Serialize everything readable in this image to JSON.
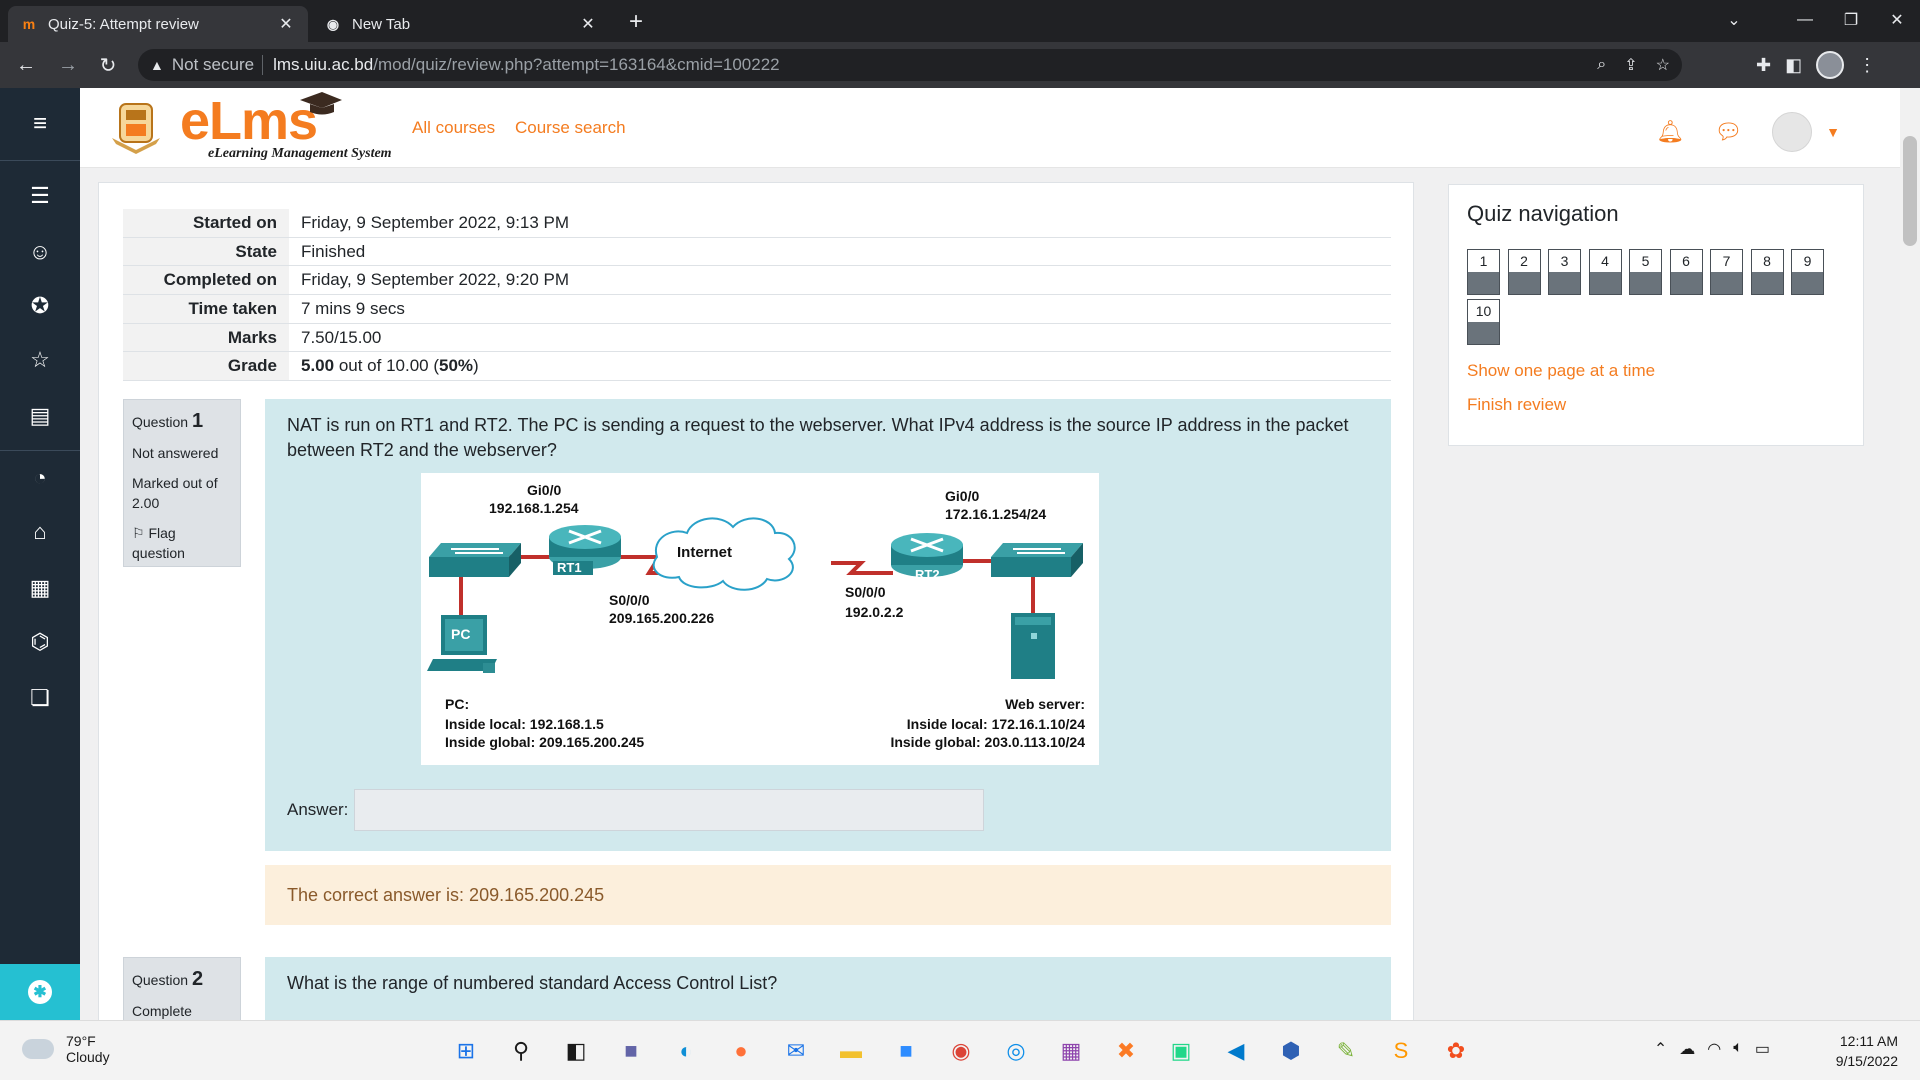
{
  "browser": {
    "tabs": [
      {
        "title": "Quiz-5: Attempt review",
        "active": true
      },
      {
        "title": "New Tab",
        "active": false
      }
    ],
    "security_label": "Not secure",
    "url_host": "lms.uiu.ac.bd",
    "url_path": "/mod/quiz/review.php?attempt=163164&cmid=100222"
  },
  "site": {
    "logo_text": "eLms",
    "logo_subtitle": "eLearning Management System",
    "links": [
      "All courses",
      "Course search"
    ]
  },
  "summary": [
    {
      "label": "Started on",
      "value": "Friday, 9 September 2022, 9:13 PM"
    },
    {
      "label": "State",
      "value": "Finished"
    },
    {
      "label": "Completed on",
      "value": "Friday, 9 September 2022, 9:20 PM"
    },
    {
      "label": "Time taken",
      "value": "7 mins 9 secs"
    },
    {
      "label": "Marks",
      "value": "7.50/15.00"
    }
  ],
  "grade": {
    "label": "Grade",
    "score": "5.00",
    "out_of": " out of 10.00 (",
    "percent": "50%",
    "close": ")"
  },
  "question1": {
    "prefix": "Question ",
    "number": "1",
    "status": "Not answered",
    "marked": "Marked out of 2.00",
    "flag": "Flag question",
    "text": "NAT is run on RT1 and RT2. The PC is sending a request to the webserver. What IPv4 address is the source IP address in the packet between RT2 and the webserver?",
    "answer_label": "Answer:",
    "answer_value": "",
    "correct_answer": "The correct answer is: 209.165.200.245",
    "diagram": {
      "rt1_gi_label": "Gi0/0",
      "rt1_gi_ip": "192.168.1.254",
      "rt2_gi_label": "Gi0/0",
      "rt2_gi_ip": "172.16.1.254/24",
      "rt1_name": "RT1",
      "rt2_name": "RT2",
      "internet": "Internet",
      "rt1_s_label": "S0/0/0",
      "rt1_s_ip": "209.165.200.226",
      "rt2_s_label": "S0/0/0",
      "rt2_s_ip": "192.0.2.2",
      "pc_name": "PC",
      "pc_title": "PC:",
      "pc_local": "Inside local:  192.168.1.5",
      "pc_global": "Inside global:  209.165.200.245",
      "ws_title": "Web server:",
      "ws_local": "Inside local:  172.16.1.10/24",
      "ws_global": "Inside global:  203.0.113.10/24"
    }
  },
  "question2": {
    "prefix": "Question ",
    "number": "2",
    "status": "Complete",
    "text": "What is the range of numbered standard Access Control List?"
  },
  "quiz_nav": {
    "title": "Quiz navigation",
    "questions": [
      "1",
      "2",
      "3",
      "4",
      "5",
      "6",
      "7",
      "8",
      "9",
      "10"
    ],
    "links": [
      "Show one page at a time",
      "Finish review"
    ]
  },
  "taskbar": {
    "temperature": "79°F",
    "condition": "Cloudy",
    "time": "12:11 AM",
    "date": "9/15/2022"
  }
}
